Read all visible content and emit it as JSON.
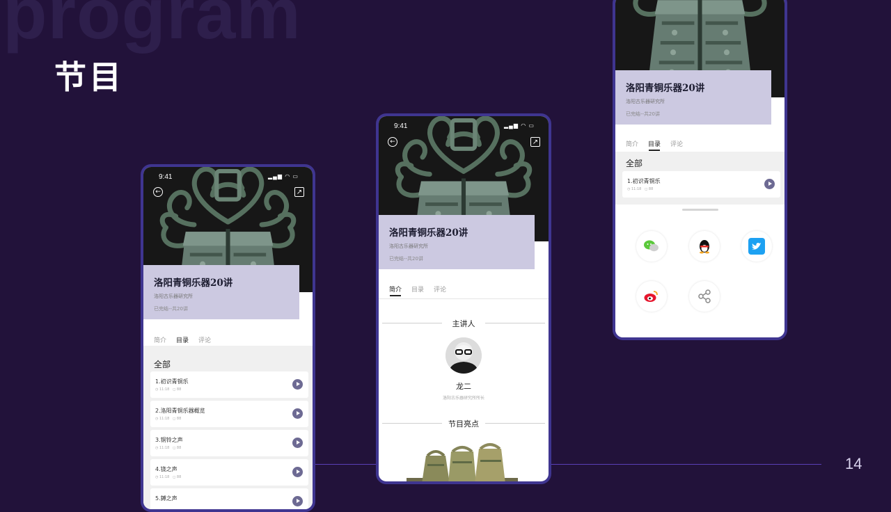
{
  "slide": {
    "bg_word": "program",
    "title": "节目",
    "page_number": "14",
    "accent_color": "#5a3fb8",
    "background_color": "#22123a"
  },
  "status_bar": {
    "time": "9:41",
    "icons": "signal-wifi-battery"
  },
  "program": {
    "title": "洛阳青铜乐器20讲",
    "institution": "洛阳古乐器研究所",
    "progress": "已完结--共20讲"
  },
  "tabs": [
    "简介",
    "目录",
    "评论"
  ],
  "catalog": {
    "section_label": "全部",
    "episodes": [
      {
        "title": "1.初识青铜乐",
        "duration": "◷ 11:18",
        "plays": "◻ 88"
      },
      {
        "title": "2.洛阳青铜乐器概览",
        "duration": "◷ 11:18",
        "plays": "◻ 88"
      },
      {
        "title": "3.铜铃之声",
        "duration": "◷ 11:18",
        "plays": "◻ 88"
      },
      {
        "title": "4.铙之声",
        "duration": "◷ 11:18",
        "plays": "◻ 88"
      },
      {
        "title": "5.鎛之声"
      }
    ]
  },
  "intro": {
    "speaker_heading": "主讲人",
    "speaker_name": "龙二",
    "speaker_title": "洛阳古乐器研究所所长",
    "highlights_heading": "节目亮点"
  },
  "share_sheet": {
    "options": [
      "wechat-icon",
      "qq-icon",
      "twitter-icon",
      "weibo-icon",
      "share-link-icon"
    ],
    "colors": {
      "wechat": "#5bc93b",
      "twitter": "#1da1f2",
      "weibo": "#e6162d"
    }
  }
}
